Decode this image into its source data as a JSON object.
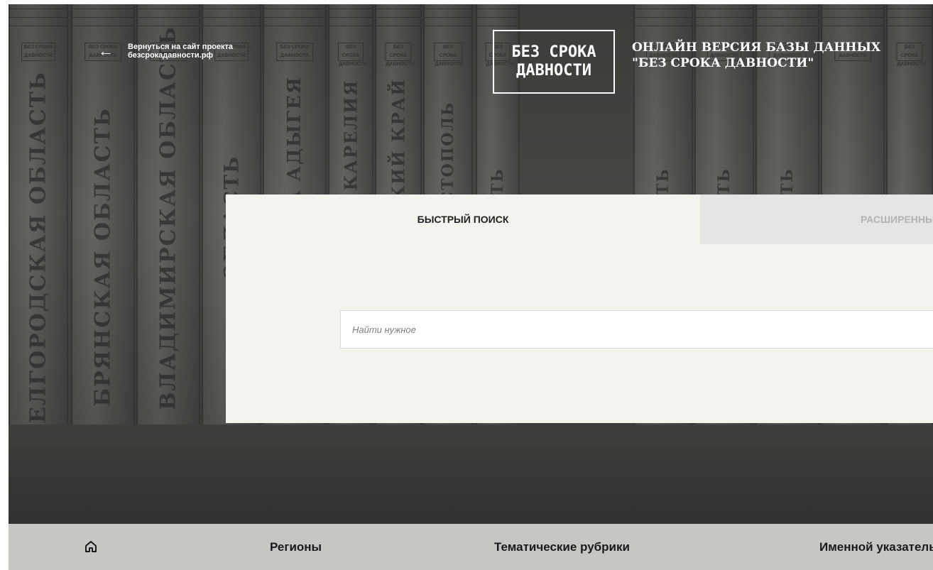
{
  "back_link": {
    "arrow": "←",
    "text": "Вернуться на сайт проекта\nбезсрокадавности.рф"
  },
  "logo": {
    "line1": "БЕЗ СРОКА",
    "line2": "ДАВНОСТИ"
  },
  "site_title": "ОНЛАЙН ВЕРСИЯ БАЗЫ ДАННЫХ\n\"БЕЗ СРОКА ДАВНОСТИ\"",
  "books": [
    {
      "spine": "БЕЛГОРОДСКАЯ ОБЛАСТЬ"
    },
    {
      "spine": "БРЯНСКАЯ ОБЛАСТЬ"
    },
    {
      "spine": "ВЛАДИМИРСКАЯ ОБЛАСТЬ"
    },
    {
      "spine": "ОБЛАСТЬ"
    },
    {
      "spine": "РЕСПУБЛИКА АДЫГЕЯ"
    },
    {
      "spine": "РЕСПУБЛИКА КАРЕЛИЯ"
    },
    {
      "spine": "КРАСНОДАРСКИЙ КРАЙ"
    },
    {
      "spine": "КРЫМ СЕВАСТОПОЛЬ"
    },
    {
      "spine": "ОБЛАСТЬ"
    },
    {
      "spine": "ОБЛАСТЬ"
    },
    {
      "spine": "ОБЛАСТЬ"
    },
    {
      "spine": "ОБЛАСТЬ"
    }
  ],
  "book_stamp": "БЕЗ СРОКА ДАВНОСТИ",
  "search": {
    "tab_quick": "БЫСТРЫЙ ПОИСК",
    "tab_advanced": "РАСШИРЕННЫЙ ПОИСК",
    "placeholder": "Найти нужное"
  },
  "nav": {
    "home_icon": "home-icon",
    "items": [
      "Регионы",
      "Тематические рубрики",
      "Именной указатель"
    ]
  },
  "colors": {
    "panel_bg": "#f5f3ee",
    "tab_inactive_bg": "#e6e5e3",
    "nav_bg": "#c7c6c3"
  }
}
